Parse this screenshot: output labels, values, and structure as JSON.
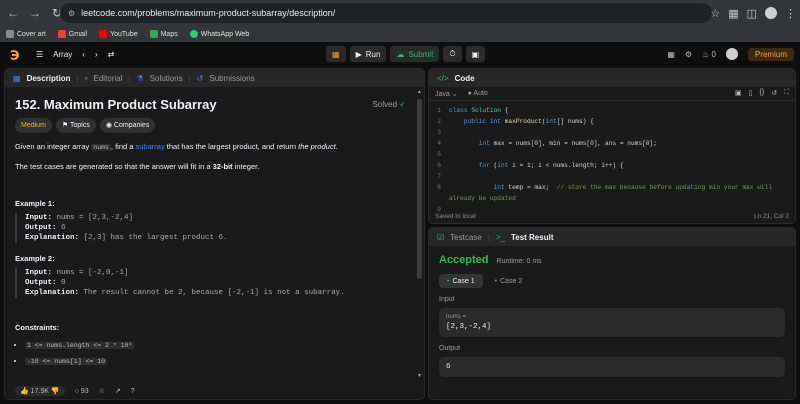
{
  "browser": {
    "url": "leetcode.com/problems/maximum-product-subarray/description/",
    "bookmarks": [
      {
        "label": "Cover art",
        "color": "#8a8a8a"
      },
      {
        "label": "Gmail",
        "color": "#ea4335"
      },
      {
        "label": "YouTube",
        "color": "#ff0000"
      },
      {
        "label": "Maps",
        "color": "#34a853"
      },
      {
        "label": "WhatsApp Web",
        "color": "#25d366"
      }
    ]
  },
  "topbar": {
    "problem_list": "Array",
    "run": "Run",
    "submit": "Submit",
    "coins": "0",
    "premium": "Premium"
  },
  "description": {
    "tabs": {
      "description": "Description",
      "editorial": "Editorial",
      "solutions": "Solutions",
      "submissions": "Submissions"
    },
    "title": "152. Maximum Product Subarray",
    "status": "Solved",
    "tags": {
      "difficulty": "Medium",
      "topics": "Topics",
      "companies": "Companies"
    },
    "p1_a": "Given an integer array ",
    "p1_code": "nums",
    "p1_b": ", find a ",
    "p1_link": "subarray",
    "p1_c": " that has the largest product, and return ",
    "p1_em": "the product",
    "p1_d": ".",
    "p2_a": "The test cases are generated so that the answer will fit in a ",
    "p2_bold": "32-bit",
    "p2_b": " integer.",
    "example1": {
      "title": "Example 1:",
      "input_label": "Input:",
      "input": "nums = [2,3,-2,4]",
      "output_label": "Output:",
      "output": "6",
      "expl_label": "Explanation:",
      "expl": "[2,3] has the largest product 6."
    },
    "example2": {
      "title": "Example 2:",
      "input_label": "Input:",
      "input": "nums = [-2,0,-1]",
      "output_label": "Output:",
      "output": "0",
      "expl_label": "Explanation:",
      "expl": "The result cannot be 2, because [-2,-1] is not a subarray."
    },
    "constraints_title": "Constraints:",
    "constraints": [
      "1 <= nums.length <= 2 * 10⁴",
      "-10 <= nums[i] <= 10"
    ],
    "footer": {
      "likes": "17.9K",
      "comments": "93"
    }
  },
  "code": {
    "title": "Code",
    "language": "Java",
    "auto": "Auto",
    "status_left": "Saved to local",
    "status_right": "Ln 21, Col 2",
    "line_numbers": [
      "1",
      "2",
      "3",
      "4",
      "5",
      "6",
      "7",
      "8",
      "9"
    ]
  },
  "result": {
    "tabs": {
      "testcase": "Testcase",
      "test_result": "Test Result"
    },
    "verdict": "Accepted",
    "runtime": "Runtime: 0 ms",
    "cases": [
      "Case 1",
      "Case 2"
    ],
    "input_label": "Input",
    "input_name": "nums =",
    "input_value": "[2,3,-2,4]",
    "output_label": "Output",
    "output_value": "6"
  }
}
